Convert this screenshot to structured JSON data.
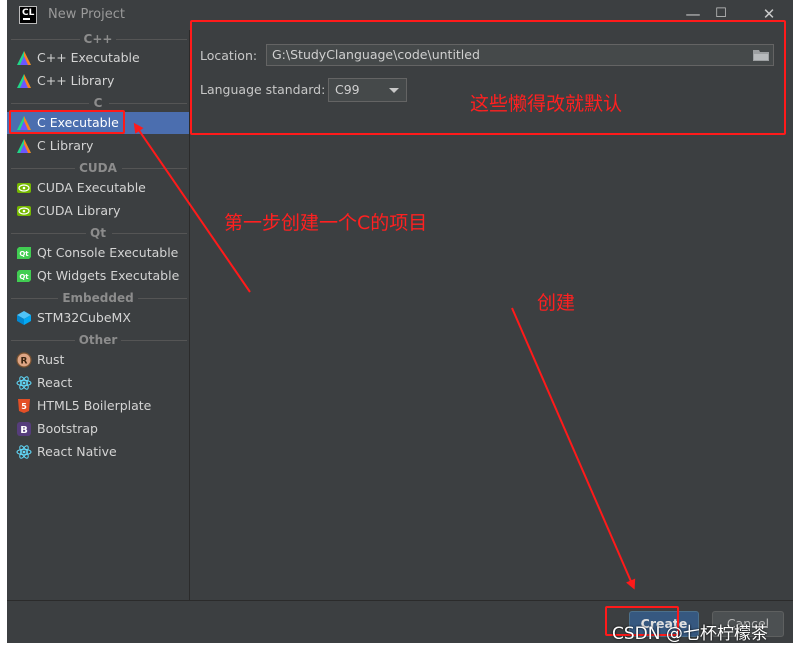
{
  "window": {
    "app_icon_text": "CL",
    "title": "New Project",
    "controls": {
      "minimize": "—",
      "maximize": "☐",
      "close": "✕"
    }
  },
  "sidebar": {
    "categories": [
      {
        "label": "C++",
        "items": [
          {
            "label": "C++ Executable",
            "icon": "clion-triangle-icon"
          },
          {
            "label": "C++ Library",
            "icon": "clion-triangle-icon"
          }
        ]
      },
      {
        "label": "C",
        "items": [
          {
            "label": "C Executable",
            "icon": "clion-triangle-icon",
            "selected": true
          },
          {
            "label": "C Library",
            "icon": "clion-triangle-icon"
          }
        ]
      },
      {
        "label": "CUDA",
        "items": [
          {
            "label": "CUDA Executable",
            "icon": "nvidia-icon"
          },
          {
            "label": "CUDA Library",
            "icon": "nvidia-icon"
          }
        ]
      },
      {
        "label": "Qt",
        "items": [
          {
            "label": "Qt Console Executable",
            "icon": "qt-icon"
          },
          {
            "label": "Qt Widgets Executable",
            "icon": "qt-icon"
          }
        ]
      },
      {
        "label": "Embedded",
        "items": [
          {
            "label": "STM32CubeMX",
            "icon": "cube-icon"
          }
        ]
      },
      {
        "label": "Other",
        "items": [
          {
            "label": "Rust",
            "icon": "rust-icon"
          },
          {
            "label": "React",
            "icon": "react-icon"
          },
          {
            "label": "HTML5 Boilerplate",
            "icon": "html5-icon"
          },
          {
            "label": "Bootstrap",
            "icon": "bootstrap-icon"
          },
          {
            "label": "React Native",
            "icon": "react-icon"
          }
        ]
      }
    ]
  },
  "form": {
    "location_label": "Location:",
    "location_value": "G:\\StudyClanguage\\code\\untitled",
    "language_label": "Language standard:",
    "language_value": "C99"
  },
  "footer": {
    "create_label": "Create",
    "cancel_label": "Cancel"
  },
  "annotations": {
    "defaults_note": "这些懒得改就默认",
    "step_one_note": "第一步创建一个C的项目",
    "create_note": "创建",
    "color": "#ff2020"
  },
  "watermark": "CSDN @七杯柠檬茶",
  "colors": {
    "window_bg": "#3c3f41",
    "selection": "#4b6eaf",
    "create_button": "#365880",
    "annotation_red": "#ff1a1a"
  }
}
